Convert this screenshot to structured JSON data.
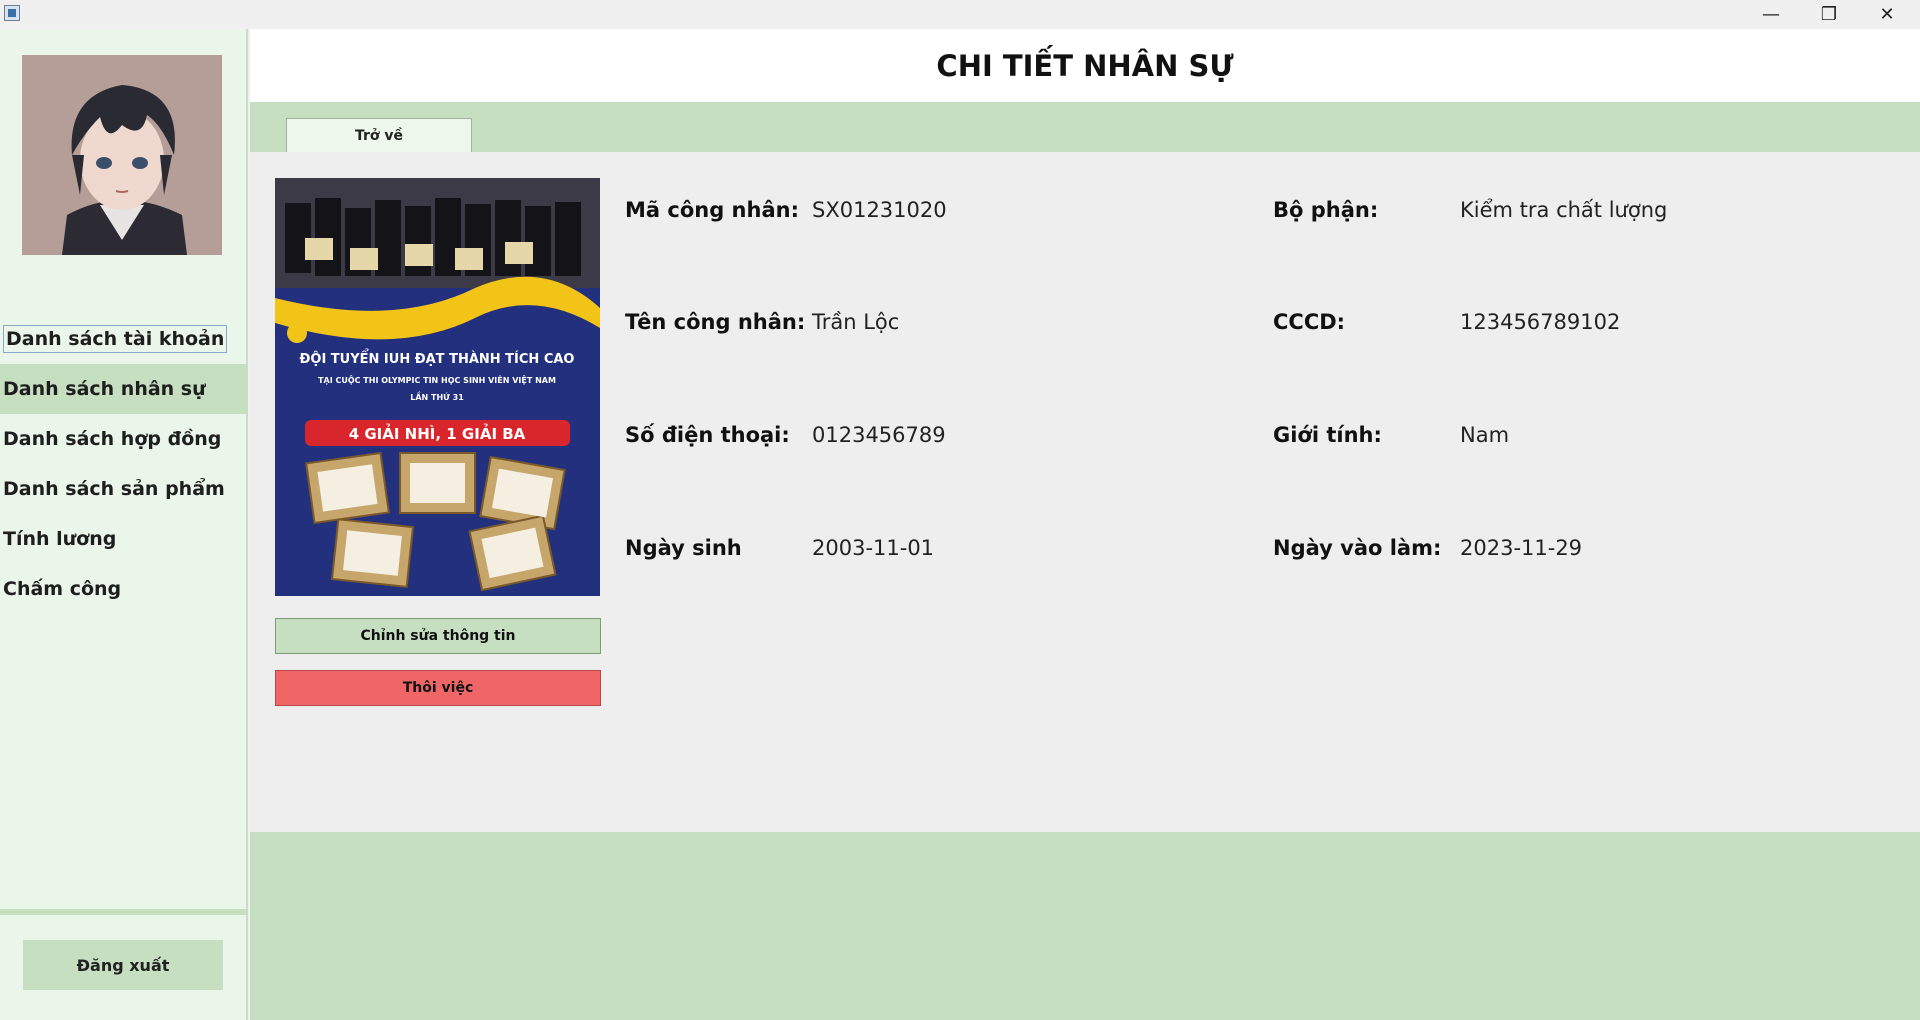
{
  "window": {
    "icon": "java-app-icon",
    "minimize": "—",
    "restore": "❐",
    "close": "✕"
  },
  "sidebar": {
    "avatar_icon": "anime-avatar-image",
    "items": [
      {
        "label": "Danh sách tài khoản",
        "active": false
      },
      {
        "label": "Danh sách nhân sự",
        "active": true
      },
      {
        "label": "Danh sách hợp đồng",
        "active": false
      },
      {
        "label": "Danh sách sản phẩm",
        "active": false
      },
      {
        "label": "Tính lương",
        "active": false
      },
      {
        "label": "Chấm công",
        "active": false
      }
    ],
    "logout_label": "Đăng xuất"
  },
  "header": {
    "title": "CHI TIẾT NHÂN SỰ"
  },
  "tabs": {
    "back_label": "Trở về"
  },
  "photo": {
    "headline": "ĐỘI TUYỂN IUH ĐẠT THÀNH TÍCH CAO",
    "subline": "TẠI CUỘC THI OLYMPIC TIN HỌC SINH VIÊN VIỆT NAM",
    "edition": "LẦN THỨ 31",
    "banner": "4 GIẢI NHÌ, 1 GIẢI BA"
  },
  "actions": {
    "edit_label": "Chỉnh sửa thông tin",
    "quit_label": "Thôi việc"
  },
  "details": {
    "employee_id": {
      "label": "Mã công nhân:",
      "value": "SX01231020"
    },
    "department": {
      "label": "Bộ phận:",
      "value": "Kiểm tra chất lượng"
    },
    "name": {
      "label": "Tên công nhân:",
      "value": "Trần Lộc"
    },
    "cccd": {
      "label": "CCCD:",
      "value": "123456789102"
    },
    "phone": {
      "label": "Số điện thoại:",
      "value": "0123456789"
    },
    "gender": {
      "label": "Giới tính:",
      "value": "Nam"
    },
    "birthday": {
      "label": "Ngày sinh",
      "value": "2003-11-01"
    },
    "start_date": {
      "label": "Ngày vào làm:",
      "value": "2023-11-29"
    }
  },
  "colors": {
    "accent_green": "#c6dfc0",
    "sidebar_bg": "#eaf6ea",
    "danger": "#f06666"
  }
}
